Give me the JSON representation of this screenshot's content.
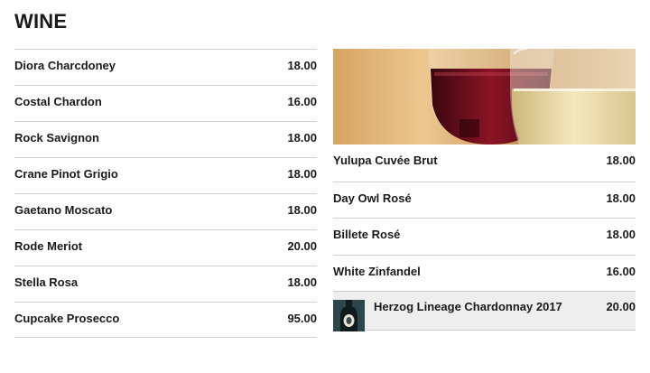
{
  "section_title": "WINE",
  "left_list": [
    {
      "name": "Diora Charcdoney",
      "price": "18.00"
    },
    {
      "name": "Costal Chardon",
      "price": "16.00"
    },
    {
      "name": "Rock Savignon",
      "price": "18.00"
    },
    {
      "name": "Crane Pinot Grigio",
      "price": "18.00"
    },
    {
      "name": "Gaetano Moscato",
      "price": "18.00"
    },
    {
      "name": "Rode Meriot",
      "price": "20.00"
    },
    {
      "name": "Stella Rosa",
      "price": "18.00"
    },
    {
      "name": "Cupcake Prosecco",
      "price": "95.00"
    }
  ],
  "right_list": [
    {
      "name": "Yulupa Cuvée Brut",
      "price": "18.00"
    },
    {
      "name": "Day Owl Rosé",
      "price": "18.00"
    },
    {
      "name": "Billete Rosé",
      "price": "18.00"
    },
    {
      "name": "White Zinfandel",
      "price": "16.00"
    }
  ],
  "featured": {
    "name": "Herzog Lineage Chardonnay 2017",
    "price": "20.00"
  },
  "colors": {
    "text": "#1a1a1a",
    "divider": "#cfcfcf",
    "featured_bg": "#eeeeee",
    "red_wine": "#7a0f1c",
    "white_wine": "#e9d9a2"
  }
}
